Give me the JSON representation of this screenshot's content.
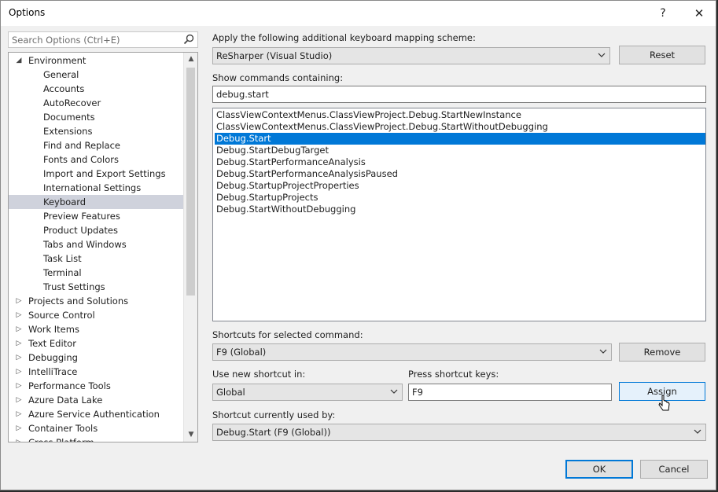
{
  "window": {
    "title": "Options",
    "help_glyph": "?",
    "close_glyph": "✕"
  },
  "search": {
    "placeholder": "Search Options (Ctrl+E)",
    "icon": "magnifier-icon"
  },
  "tree": {
    "items": [
      {
        "label": "Environment",
        "level": 0,
        "expander": "◢",
        "selected": false
      },
      {
        "label": "General",
        "level": 1,
        "expander": "",
        "selected": false
      },
      {
        "label": "Accounts",
        "level": 1,
        "expander": "",
        "selected": false
      },
      {
        "label": "AutoRecover",
        "level": 1,
        "expander": "",
        "selected": false
      },
      {
        "label": "Documents",
        "level": 1,
        "expander": "",
        "selected": false
      },
      {
        "label": "Extensions",
        "level": 1,
        "expander": "",
        "selected": false
      },
      {
        "label": "Find and Replace",
        "level": 1,
        "expander": "",
        "selected": false
      },
      {
        "label": "Fonts and Colors",
        "level": 1,
        "expander": "",
        "selected": false
      },
      {
        "label": "Import and Export Settings",
        "level": 1,
        "expander": "",
        "selected": false
      },
      {
        "label": "International Settings",
        "level": 1,
        "expander": "",
        "selected": false
      },
      {
        "label": "Keyboard",
        "level": 1,
        "expander": "",
        "selected": true
      },
      {
        "label": "Preview Features",
        "level": 1,
        "expander": "",
        "selected": false
      },
      {
        "label": "Product Updates",
        "level": 1,
        "expander": "",
        "selected": false
      },
      {
        "label": "Tabs and Windows",
        "level": 1,
        "expander": "",
        "selected": false
      },
      {
        "label": "Task List",
        "level": 1,
        "expander": "",
        "selected": false
      },
      {
        "label": "Terminal",
        "level": 1,
        "expander": "",
        "selected": false
      },
      {
        "label": "Trust Settings",
        "level": 1,
        "expander": "",
        "selected": false
      },
      {
        "label": "Projects and Solutions",
        "level": 0,
        "expander": "▷",
        "selected": false
      },
      {
        "label": "Source Control",
        "level": 0,
        "expander": "▷",
        "selected": false
      },
      {
        "label": "Work Items",
        "level": 0,
        "expander": "▷",
        "selected": false
      },
      {
        "label": "Text Editor",
        "level": 0,
        "expander": "▷",
        "selected": false
      },
      {
        "label": "Debugging",
        "level": 0,
        "expander": "▷",
        "selected": false
      },
      {
        "label": "IntelliTrace",
        "level": 0,
        "expander": "▷",
        "selected": false
      },
      {
        "label": "Performance Tools",
        "level": 0,
        "expander": "▷",
        "selected": false
      },
      {
        "label": "Azure Data Lake",
        "level": 0,
        "expander": "▷",
        "selected": false
      },
      {
        "label": "Azure Service Authentication",
        "level": 0,
        "expander": "▷",
        "selected": false
      },
      {
        "label": "Container Tools",
        "level": 0,
        "expander": "▷",
        "selected": false
      },
      {
        "label": "Cross Platform",
        "level": 0,
        "expander": "▷",
        "selected": false
      }
    ],
    "scroll_up_glyph": "▲",
    "scroll_down_glyph": "▼"
  },
  "mapping": {
    "label": "Apply the following additional keyboard mapping scheme:",
    "value": "ReSharper (Visual Studio)",
    "reset_label": "Reset"
  },
  "commands": {
    "label": "Show commands containing:",
    "filter": "debug.start",
    "items": [
      {
        "text": "ClassViewContextMenus.ClassViewProject.Debug.StartNewInstance",
        "selected": false
      },
      {
        "text": "ClassViewContextMenus.ClassViewProject.Debug.StartWithoutDebugging",
        "selected": false
      },
      {
        "text": "Debug.Start",
        "selected": true
      },
      {
        "text": "Debug.StartDebugTarget",
        "selected": false
      },
      {
        "text": "Debug.StartPerformanceAnalysis",
        "selected": false
      },
      {
        "text": "Debug.StartPerformanceAnalysisPaused",
        "selected": false
      },
      {
        "text": "Debug.StartupProjectProperties",
        "selected": false
      },
      {
        "text": "Debug.StartupProjects",
        "selected": false
      },
      {
        "text": "Debug.StartWithoutDebugging",
        "selected": false
      }
    ]
  },
  "shortcuts": {
    "label": "Shortcuts for selected command:",
    "value": "F9 (Global)",
    "remove_label": "Remove"
  },
  "new_shortcut": {
    "use_in_label": "Use new shortcut in:",
    "use_in_value": "Global",
    "press_label": "Press shortcut keys:",
    "press_value": "F9",
    "assign_label": "Assign"
  },
  "used_by": {
    "label": "Shortcut currently used by:",
    "value": "Debug.Start (F9 (Global))"
  },
  "footer": {
    "ok_label": "OK",
    "cancel_label": "Cancel"
  }
}
